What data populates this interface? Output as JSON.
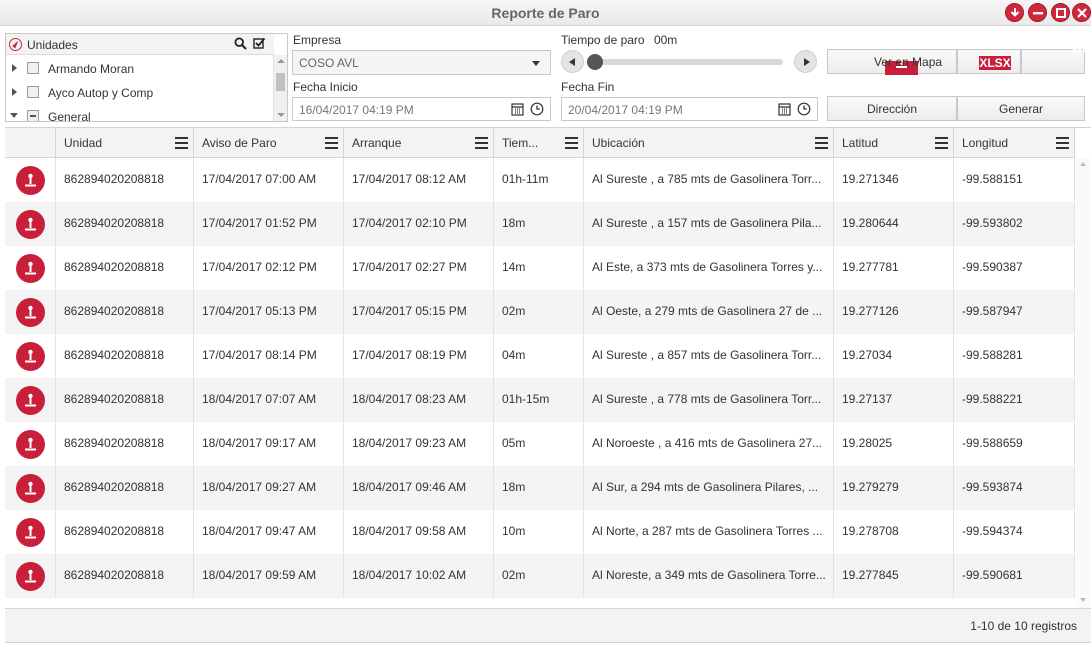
{
  "window": {
    "title": "Reporte de Paro"
  },
  "tree": {
    "header": "Unidades",
    "items": [
      {
        "label": "Armando Moran",
        "expanded": false,
        "checked": false
      },
      {
        "label": "Ayco Autop y Comp",
        "expanded": false,
        "checked": false
      },
      {
        "label": "General",
        "expanded": true,
        "checked": "partial"
      }
    ]
  },
  "form": {
    "empresa_label": "Empresa",
    "empresa_value": "COSO AVL",
    "fecha_inicio_label": "Fecha Inicio",
    "fecha_inicio_value": "16/04/2017 04:19 PM",
    "fecha_fin_label": "Fecha Fin",
    "fecha_fin_value": "20/04/2017 04:19 PM",
    "tiempo_label": "Tiempo de paro",
    "tiempo_value": "00m",
    "slider_level": 0
  },
  "buttons": {
    "ver_en_mapa": "Ver en Mapa",
    "xlsx": "XLSX",
    "direccion": "Dirección",
    "generar": "Generar"
  },
  "table": {
    "columns": [
      "Unidad",
      "Aviso de Paro",
      "Arranque",
      "Tiem...",
      "Ubicación",
      "Latitud",
      "Longitud"
    ],
    "rows": [
      [
        "862894020208818",
        "17/04/2017 07:00 AM",
        "17/04/2017 08:12 AM",
        "01h-11m",
        "Al Sureste , a 785 mts de Gasolinera Torr...",
        "19.271346",
        "-99.588151"
      ],
      [
        "862894020208818",
        "17/04/2017 01:52 PM",
        "17/04/2017 02:10 PM",
        "18m",
        "Al Sureste , a 157 mts de Gasolinera Pila...",
        "19.280644",
        "-99.593802"
      ],
      [
        "862894020208818",
        "17/04/2017 02:12 PM",
        "17/04/2017 02:27 PM",
        "14m",
        "Al Este, a 373 mts de Gasolinera Torres y...",
        "19.277781",
        "-99.590387"
      ],
      [
        "862894020208818",
        "17/04/2017 05:13 PM",
        "17/04/2017 05:15 PM",
        "02m",
        "Al Oeste, a 279 mts de Gasolinera 27 de ...",
        "19.277126",
        "-99.587947"
      ],
      [
        "862894020208818",
        "17/04/2017 08:14 PM",
        "17/04/2017 08:19 PM",
        "04m",
        "Al Sureste , a 857 mts de Gasolinera Torr...",
        "19.27034",
        "-99.588281"
      ],
      [
        "862894020208818",
        "18/04/2017 07:07 AM",
        "18/04/2017 08:23 AM",
        "01h-15m",
        "Al Sureste , a 778 mts de Gasolinera Torr...",
        "19.27137",
        "-99.588221"
      ],
      [
        "862894020208818",
        "18/04/2017 09:17 AM",
        "18/04/2017 09:23 AM",
        "05m",
        "Al Noroeste , a 416 mts de Gasolinera 27...",
        "19.28025",
        "-99.588659"
      ],
      [
        "862894020208818",
        "18/04/2017 09:27 AM",
        "18/04/2017 09:46 AM",
        "18m",
        "Al Sur, a 294 mts de Gasolinera Pilares, ...",
        "19.279279",
        "-99.593874"
      ],
      [
        "862894020208818",
        "18/04/2017 09:47 AM",
        "18/04/2017 09:58 AM",
        "10m",
        "Al Norte, a 287 mts de Gasolinera Torres ...",
        "19.278708",
        "-99.594374"
      ],
      [
        "862894020208818",
        "18/04/2017 09:59 AM",
        "18/04/2017 10:02 AM",
        "02m",
        "Al Noreste, a 349 mts de Gasolinera Torre...",
        "19.277845",
        "-99.590681"
      ]
    ]
  },
  "footer": {
    "count": "1-10 de 10 registros"
  },
  "colors": {
    "accent": "#c8203a",
    "header_bg": "#f3f3f3",
    "alt_row": "#f4f4f4"
  },
  "icons": [
    "download-icon",
    "minimize-icon",
    "maximize-icon",
    "close-icon",
    "compass-icon",
    "search-icon",
    "checkbox-icon",
    "calendar-icon",
    "clock-icon",
    "stop-marker-icon",
    "column-menu-icon"
  ]
}
